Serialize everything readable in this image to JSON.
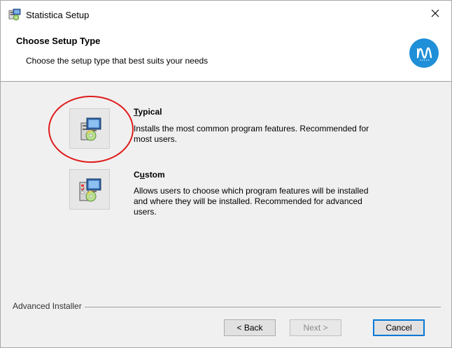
{
  "window": {
    "title": "Statistica Setup"
  },
  "header": {
    "title": "Choose Setup Type",
    "subtitle": "Choose the setup type that best suits your needs"
  },
  "options": [
    {
      "id": "typical",
      "title_prefix": "",
      "title_accel": "T",
      "title_rest": "ypical",
      "description_lines": [
        "Installs the most common program features. Recommended for",
        "most users."
      ]
    },
    {
      "id": "custom",
      "title_prefix": "C",
      "title_accel": "u",
      "title_rest": "stom",
      "description_lines": [
        "Allows users to choose which program features will be installed",
        "and where they will be installed. Recommended for advanced",
        "users."
      ]
    }
  ],
  "footer": {
    "group_label": "Advanced Installer"
  },
  "buttons": {
    "back": "< Back",
    "next": "Next >",
    "cancel": "Cancel"
  },
  "colors": {
    "brand_blue": "#1f8fd8",
    "highlight_red": "#e01b1b",
    "default_button_border": "#0078d7"
  },
  "icons": {
    "app": "installer-package-icon",
    "close": "close-icon",
    "brand": "statistica-logo-icon",
    "typical": "typical-install-icon",
    "custom": "custom-install-icon"
  }
}
